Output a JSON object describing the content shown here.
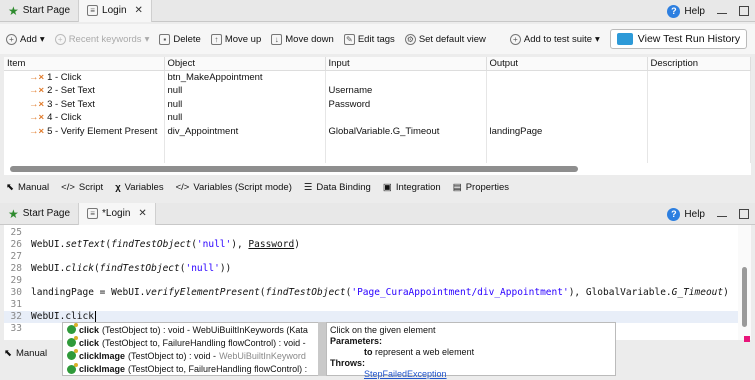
{
  "top_tabs": [
    {
      "label": "Start Page",
      "icon": "start-icon"
    },
    {
      "label": "Login",
      "icon": "testcase-icon",
      "active": true
    }
  ],
  "help_label": "Help",
  "toolbar": {
    "add": "Add",
    "recent": "Recent keywords",
    "delete": "Delete",
    "move_up": "Move up",
    "move_down": "Move down",
    "edit_tags": "Edit tags",
    "set_default_view": "Set default view",
    "add_to_suite": "Add to test suite",
    "view_history": "View Test Run History"
  },
  "table": {
    "headers": [
      "Item",
      "Object",
      "Input",
      "Output",
      "Description"
    ],
    "rows": [
      {
        "item": "1 - Click",
        "object": "btn_MakeAppointment",
        "input": "",
        "output": "",
        "description": ""
      },
      {
        "item": "2 - Set Text",
        "object": "null",
        "input": "Username",
        "output": "",
        "description": ""
      },
      {
        "item": "3 - Set Text",
        "object": "null",
        "input": "Password",
        "output": "",
        "description": ""
      },
      {
        "item": "4 - Click",
        "object": "null",
        "input": "",
        "output": "",
        "description": ""
      },
      {
        "item": "5 - Verify Element Present",
        "object": "div_Appointment",
        "input": "GlobalVariable.G_Timeout",
        "output": "landingPage",
        "description": ""
      }
    ]
  },
  "sub_tabs": [
    "Manual",
    "Script",
    "Variables",
    "Variables (Script mode)",
    "Data Binding",
    "Integration",
    "Properties"
  ],
  "editor_tabs": [
    {
      "label": "Start Page"
    },
    {
      "label": "*Login",
      "active": true
    }
  ],
  "editor": {
    "line_numbers": [
      "25",
      "26",
      "27",
      "28",
      "29",
      "30",
      "31",
      "32",
      "33"
    ],
    "line26_pre": "WebUI.",
    "line26_fn": "setText",
    "line26_a": "(",
    "line26_b": "findTestObject",
    "line26_c": "(",
    "line26_str": "'null'",
    "line26_d": "), ",
    "line26_var": "Password",
    "line26_e": ")",
    "line28_pre": "WebUI.",
    "line28_fn": "click",
    "line28_a": "(",
    "line28_b": "findTestObject",
    "line28_c": "(",
    "line28_str": "'null'",
    "line28_d": "))",
    "line30_a": "landingPage",
    "line30_b": " = WebUI.",
    "line30_fn": "verifyElementPresent",
    "line30_c": "(",
    "line30_d": "findTestObject",
    "line30_e": "(",
    "line30_str": "'Page_CuraAppointment/div_Appointment'",
    "line30_f": "), GlobalVariable.",
    "line30_g": "G_Timeout",
    "line30_h": ")",
    "line32": "WebUI.click"
  },
  "autocomplete": [
    {
      "name": "click",
      "sig": "(TestObject to) : void - WebUiBuiltInKeywords (Kata"
    },
    {
      "name": "click",
      "sig": "(TestObject to, FailureHandling flowControl) : void -"
    },
    {
      "name": "clickImage",
      "sig": "(TestObject to) : void - ",
      "src": "WebUiBuiltInKeyword"
    },
    {
      "name": "clickImage",
      "sig": "(TestObject to, FailureHandling flowControl) :"
    }
  ],
  "doc": {
    "desc": "Click on the given element",
    "params_label": "Parameters:",
    "param": "to",
    "param_desc": "represent a web element",
    "throws_label": "Throws:",
    "throws_link": "StepFailedException"
  },
  "bottom_tab": "Manual"
}
